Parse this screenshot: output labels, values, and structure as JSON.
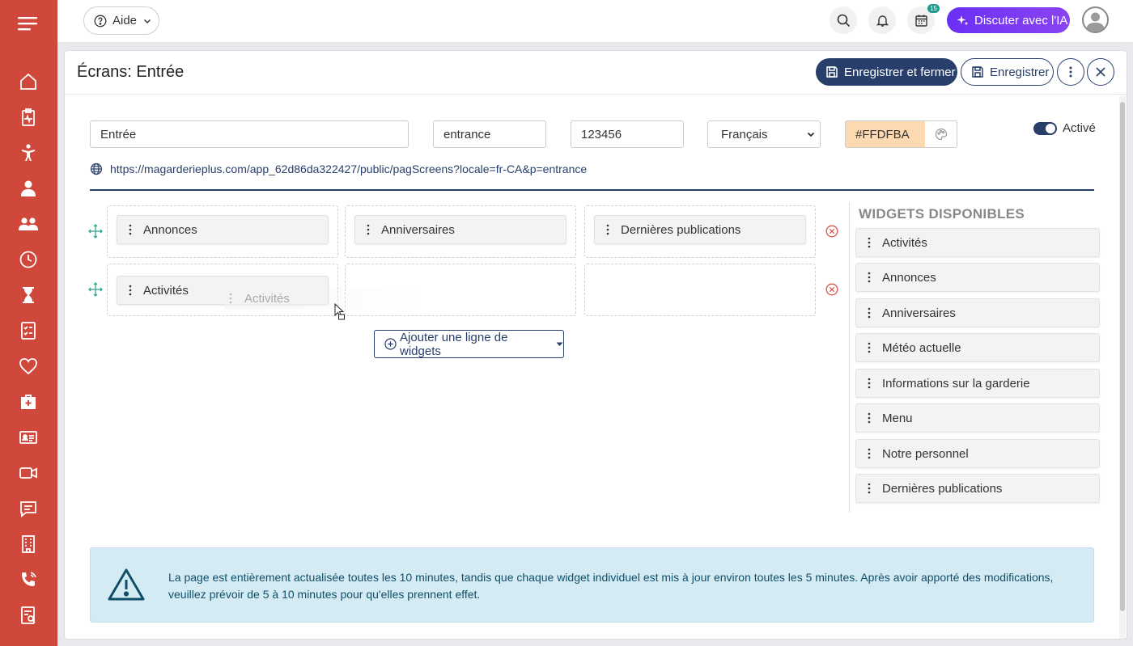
{
  "topbar": {
    "help_label": "Aide",
    "calendar_badge": "15",
    "ai_label": "Discuter avec l'IA"
  },
  "sidebar": {
    "items": [
      "home-icon",
      "clipboard-pulse-icon",
      "child-icon",
      "person-icon",
      "group-icon",
      "clock-icon",
      "hourglass-icon",
      "checklist-icon",
      "heart-icon",
      "first-aid-icon",
      "id-card-icon",
      "video-icon",
      "chat-icon",
      "building-icon",
      "phone-icon",
      "report-icon"
    ]
  },
  "page": {
    "title": "Écrans: Entrée",
    "save_close_label": "Enregistrer et fermer",
    "save_label": "Enregistrer"
  },
  "form": {
    "name_value": "Entrée",
    "slug_value": "entrance",
    "code_value": "123456",
    "language_value": "Français",
    "color_value": "#FFDFBA",
    "active_label": "Activé",
    "url": "https://magarderieplus.com/app_62d86da322427/public/pagScreens?locale=fr-CA&p=entrance"
  },
  "layout": {
    "rows": [
      [
        "Annonces",
        "Anniversaires",
        "Dernières publications"
      ],
      [
        "Activités",
        "",
        ""
      ]
    ],
    "ghost_label": "Activités",
    "add_row_label": "Ajouter une ligne de widgets"
  },
  "available": {
    "title": "WIDGETS DISPONIBLES",
    "items": [
      "Activités",
      "Annonces",
      "Anniversaires",
      "Météo actuelle",
      "Informations sur la garderie",
      "Menu",
      "Notre personnel",
      "Dernières publications"
    ]
  },
  "info": {
    "text": "La page est entièrement actualisée toutes les 10 minutes, tandis que chaque widget individuel est mis à jour environ toutes les 5 minutes. Après avoir apporté des modifications, veuillez prévoir de 5 à 10 minutes pour qu'elles prennent effet."
  },
  "colors": {
    "sidebar": "#d0483b",
    "primary": "#283e6b",
    "ai_gradient_start": "#6b2ff5",
    "color_swatch": "#FFDFBA",
    "info_bg": "#d4ebf4"
  }
}
